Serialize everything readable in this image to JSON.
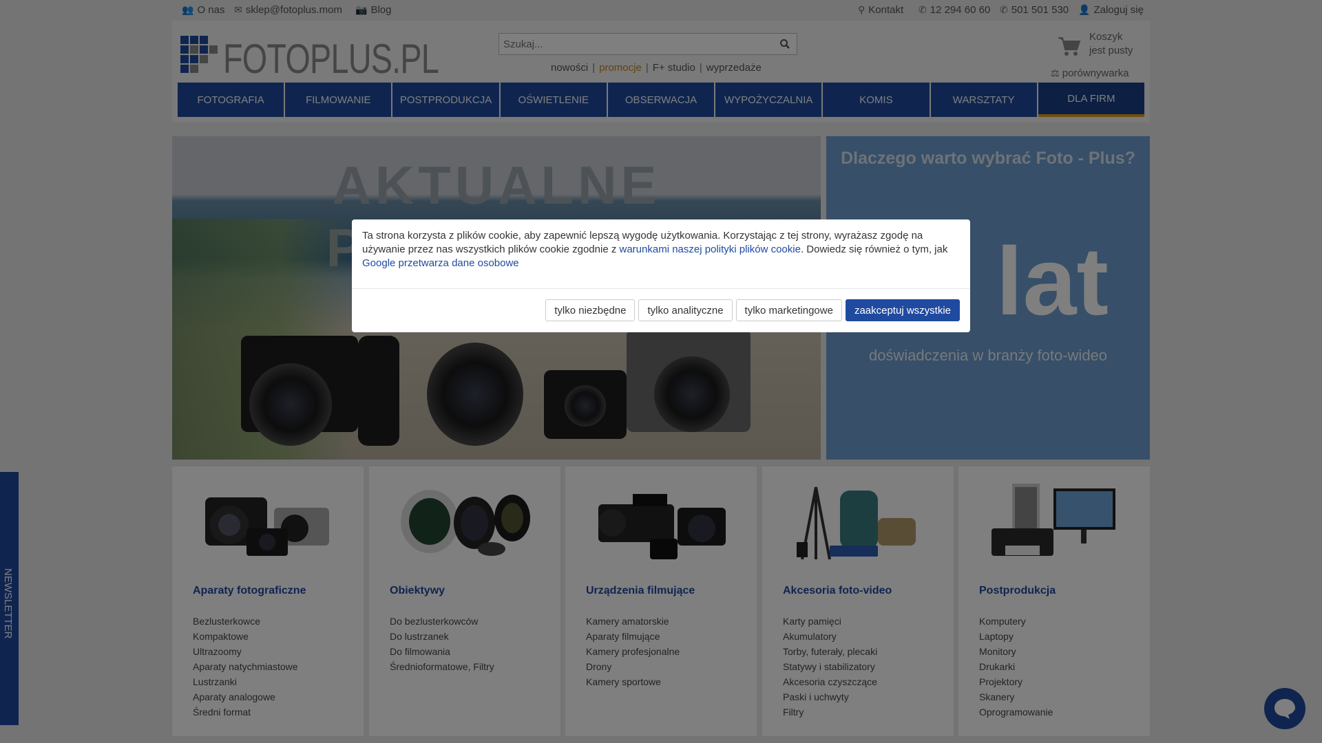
{
  "topbar": {
    "about": "O nas",
    "email": "sklep@fotoplus.mom",
    "blog": "Blog",
    "contact": "Kontakt",
    "phone1": "12 294 60 60",
    "phone2": "501 501 530",
    "login": "Zaloguj się"
  },
  "header": {
    "logo_text": "FOTOPLUS.PL",
    "search_placeholder": "Szukaj...",
    "quick_links": [
      "nowości",
      "promocje",
      "F+ studio",
      "wyprzedaże"
    ],
    "cart_line1": "Koszyk",
    "cart_line2": "jest pusty",
    "compare": "porównywarka"
  },
  "nav": [
    "FOTOGRAFIA",
    "FILMOWANIE",
    "POSTPRODUKCJA",
    "OŚWIETLENIE",
    "OBSERWACJA",
    "WYPOŻYCZALNIA",
    "KOMIS",
    "WARSZTATY",
    "DLA FIRM"
  ],
  "banner": {
    "title": "AKTUALNE PROMOCJE"
  },
  "side": {
    "heading": "Dlaczego warto wybrać Foto - Plus?",
    "big": "lat",
    "sub": "doświadczenia w branży foto-wideo"
  },
  "categories": [
    {
      "title": "Aparaty fotograficzne",
      "items": [
        "Bezlusterkowce",
        "Kompaktowe",
        "Ultrazoomy",
        "Aparaty natychmiastowe",
        "Lustrzanki",
        "Aparaty analogowe",
        "Średni format"
      ]
    },
    {
      "title": "Obiektywy",
      "items": [
        "Do bezlusterkowców",
        "Do lustrzanek",
        "Do filmowania",
        "Średnioformatowe, Filtry"
      ]
    },
    {
      "title": "Urządzenia filmujące",
      "items": [
        "Kamery amatorskie",
        "Aparaty filmujące",
        "Kamery profesjonalne",
        "Drony",
        "Kamery sportowe"
      ]
    },
    {
      "title": "Akcesoria foto-video",
      "items": [
        "Karty pamięci",
        "Akumulatory",
        "Torby, futerały, plecaki",
        "Statywy i stabilizatory",
        "Akcesoria czyszczące",
        "Paski i uchwyty",
        "Filtry"
      ]
    },
    {
      "title": "Postprodukcja",
      "items": [
        "Komputery",
        "Laptopy",
        "Monitory",
        "Drukarki",
        "Projektory",
        "Skanery",
        "Oprogramowanie"
      ]
    }
  ],
  "newsletter": "NEWSLETTER",
  "cookie": {
    "text1": "Ta strona korzysta z plików cookie, aby zapewnić lepszą wygodę użytkowania. Korzystając z tej strony, wyrażasz zgodę na używanie przez nas wszystkich plików cookie zgodnie z ",
    "link1": "warunkami naszej polityki plików cookie",
    "text2": ". Dowiedz się również o tym, jak ",
    "link2": "Google przetwarza dane osobowe",
    "buttons": [
      "tylko niezbędne",
      "tylko analityczne",
      "tylko marketingowe",
      "zaakceptuj wszystkie"
    ]
  },
  "colors": {
    "brand": "#1f4aa0",
    "accent": "#e0a020",
    "promo": "#c9871a"
  }
}
